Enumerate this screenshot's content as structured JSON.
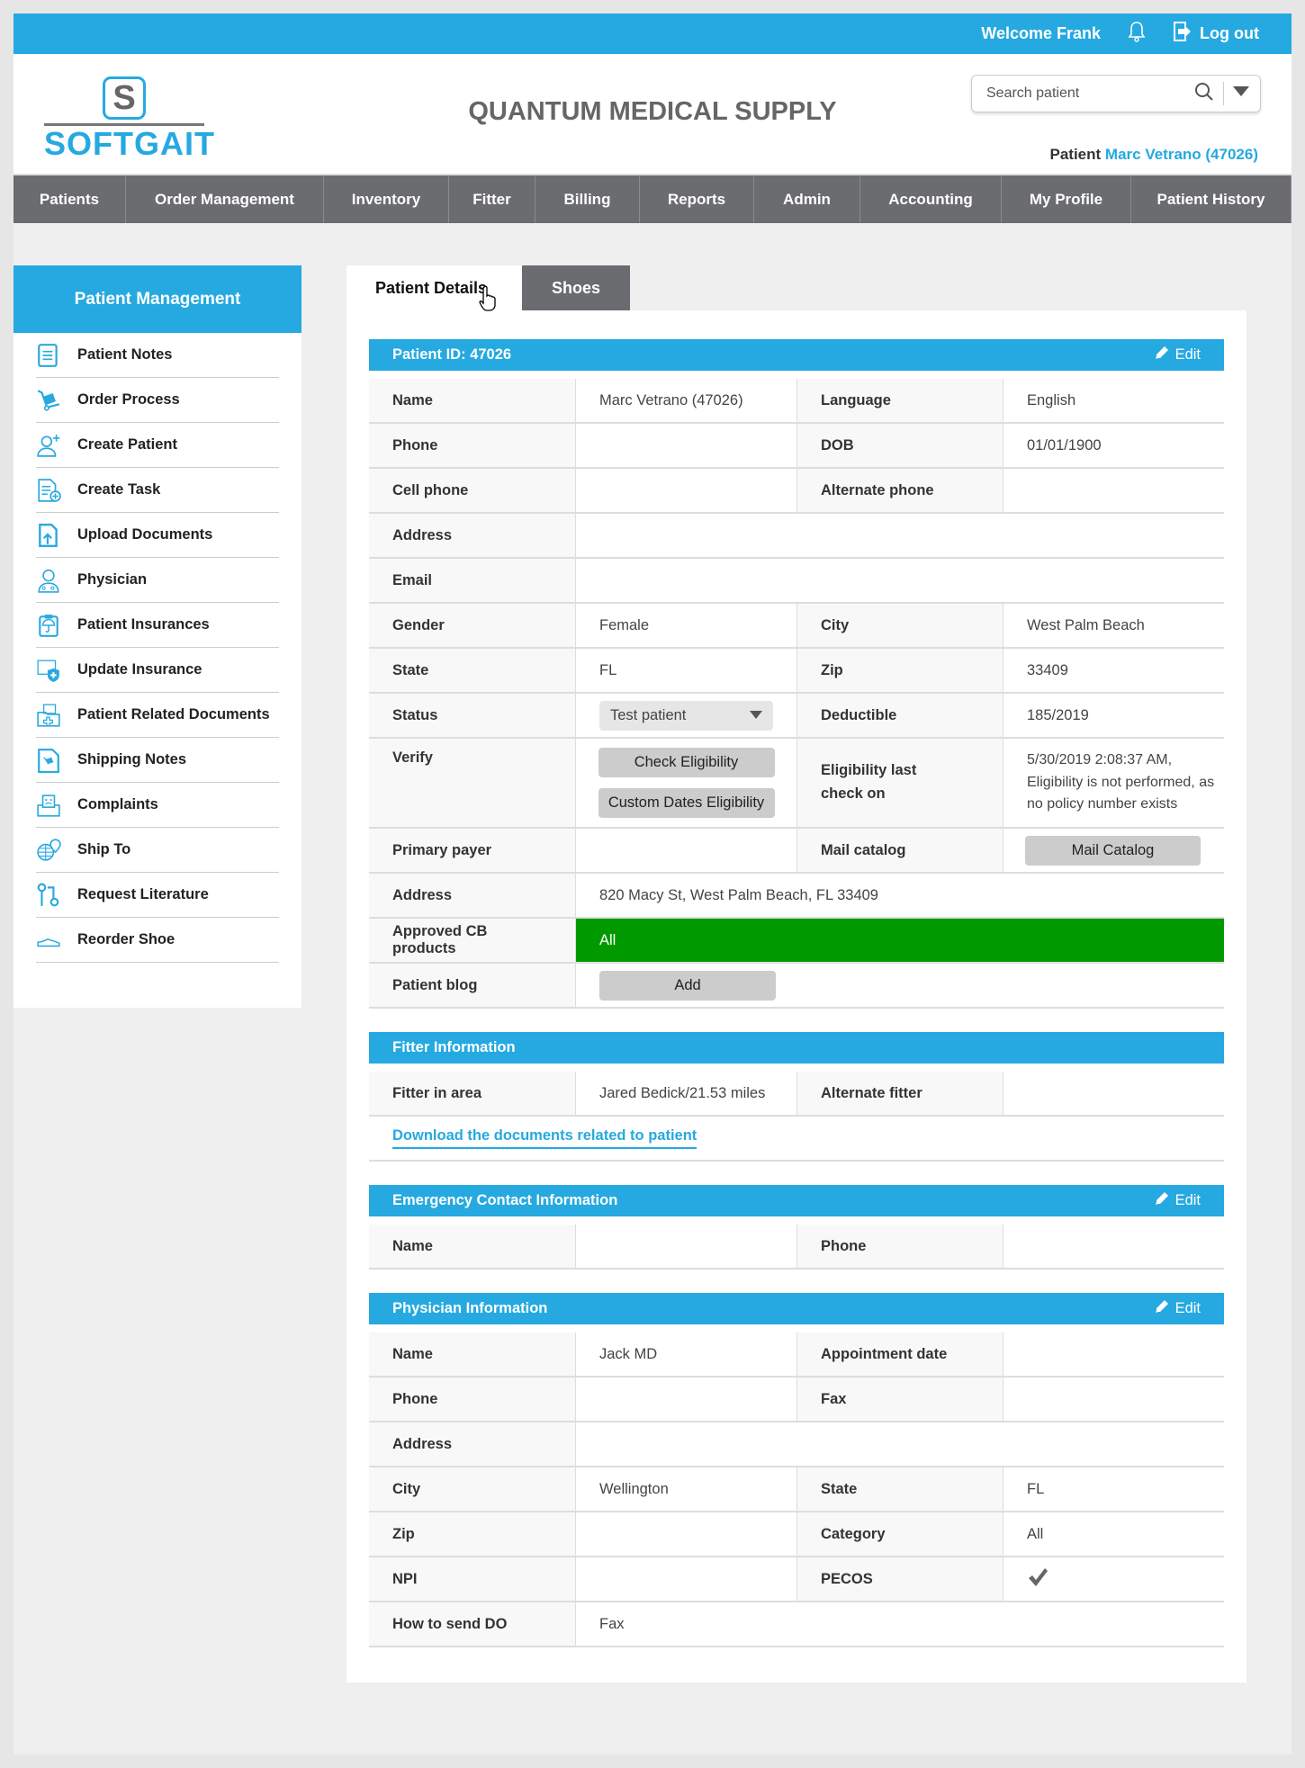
{
  "topbar": {
    "welcome": "Welcome Frank",
    "logout": "Log out"
  },
  "logo": {
    "mark": "S",
    "word": "SOFTGAIT"
  },
  "header": {
    "company": "QUANTUM MEDICAL SUPPLY",
    "search_placeholder": "Search patient",
    "patient_label": "Patient",
    "patient_name": "Marc Vetrano (47026)"
  },
  "nav": [
    "Patients",
    "Order Management",
    "Inventory",
    "Fitter",
    "Billing",
    "Reports",
    "Admin",
    "Accounting",
    "My Profile",
    "Patient History"
  ],
  "sidebar": {
    "title": "Patient Management",
    "items": [
      {
        "label": "Patient Notes",
        "icon": "document-icon"
      },
      {
        "label": "Order Process",
        "icon": "hand-truck-icon"
      },
      {
        "label": "Create Patient",
        "icon": "add-user-icon"
      },
      {
        "label": "Create Task",
        "icon": "add-task-icon"
      },
      {
        "label": "Upload Documents",
        "icon": "upload-document-icon"
      },
      {
        "label": "Physician",
        "icon": "physician-icon"
      },
      {
        "label": "Patient Insurances",
        "icon": "insurance-clipboard-icon"
      },
      {
        "label": "Update Insurance",
        "icon": "shield-plus-icon"
      },
      {
        "label": "Patient Related Documents",
        "icon": "medical-folder-icon"
      },
      {
        "label": "Shipping Notes",
        "icon": "shipping-note-icon"
      },
      {
        "label": "Complaints",
        "icon": "complaint-box-icon"
      },
      {
        "label": "Ship To",
        "icon": "globe-pin-icon"
      },
      {
        "label": "Request Literature",
        "icon": "route-icon"
      },
      {
        "label": "Reorder Shoe",
        "icon": "shoe-icon"
      }
    ]
  },
  "tabs": {
    "active": "Patient Details",
    "other": "Shoes"
  },
  "edit_label": "Edit",
  "sections": [
    {
      "title": "Patient ID: 47026",
      "editable": true,
      "rows": [
        {
          "type": "pair",
          "l1": "Name",
          "v1": "Marc Vetrano (47026)",
          "l2": "Language",
          "v2": "English"
        },
        {
          "type": "pair",
          "l1": "Phone",
          "v1": "",
          "l2": "DOB",
          "v2": "01/01/1900"
        },
        {
          "type": "pair",
          "l1": "Cell phone",
          "v1": "",
          "l2": "Alternate phone",
          "v2": ""
        },
        {
          "type": "wide",
          "l1": "Address",
          "v1": ""
        },
        {
          "type": "wide",
          "l1": "Email",
          "v1": ""
        },
        {
          "type": "pair",
          "l1": "Gender",
          "v1": "Female",
          "l2": "City",
          "v2": "West Palm Beach"
        },
        {
          "type": "pair",
          "l1": "State",
          "v1": "FL",
          "l2": "Zip",
          "v2": "33409"
        },
        {
          "type": "select",
          "l1": "Status",
          "v1": "Test patient",
          "l2": "Deductible",
          "v2": "185/2019"
        },
        {
          "type": "verify",
          "l1": "Verify",
          "b1": "Check Eligibility",
          "b2": "Custom Dates Eligibility",
          "l2": "Eligibility last check on",
          "v2": "5/30/2019 2:08:37 AM, Eligibility is not performed, as no policy number exists"
        },
        {
          "type": "button2",
          "l1": "Primary payer",
          "v1": "",
          "l2": "Mail catalog",
          "b2": "Mail Catalog"
        },
        {
          "type": "wide",
          "l1": "Address",
          "v1": "820 Macy St, West Palm Beach, FL 33409"
        },
        {
          "type": "green",
          "l1": "Approved CB products",
          "v1": "All"
        },
        {
          "type": "button1",
          "l1": "Patient blog",
          "b1": "Add"
        }
      ]
    },
    {
      "title": "Fitter Information",
      "editable": false,
      "rows": [
        {
          "type": "pair",
          "l1": "Fitter in area",
          "v1": "Jared Bedick/21.53 miles",
          "l2": "Alternate fitter",
          "v2": ""
        }
      ],
      "link": "Download the documents related to patient"
    },
    {
      "title": "Emergency Contact Information",
      "editable": true,
      "rows": [
        {
          "type": "pair",
          "l1": "Name",
          "v1": "",
          "l2": "Phone",
          "v2": ""
        }
      ]
    },
    {
      "title": "Physician Information",
      "editable": true,
      "rows": [
        {
          "type": "pair",
          "l1": "Name",
          "v1": "Jack MD",
          "l2": "Appointment date",
          "v2": ""
        },
        {
          "type": "pair",
          "l1": "Phone",
          "v1": "",
          "l2": "Fax",
          "v2": ""
        },
        {
          "type": "wide",
          "l1": "Address",
          "v1": ""
        },
        {
          "type": "pair",
          "l1": "City",
          "v1": "Wellington",
          "l2": "State",
          "v2": "FL"
        },
        {
          "type": "pair",
          "l1": "Zip",
          "v1": "",
          "l2": "Category",
          "v2": "All"
        },
        {
          "type": "check",
          "l1": "NPI",
          "v1": "",
          "l2": "PECOS",
          "checked": true
        },
        {
          "type": "wide",
          "l1": "How to send DO",
          "v1": "Fax"
        }
      ]
    }
  ],
  "colors": {
    "accent": "#25a9e0",
    "nav": "#6b6c70",
    "approved": "#009a00"
  }
}
